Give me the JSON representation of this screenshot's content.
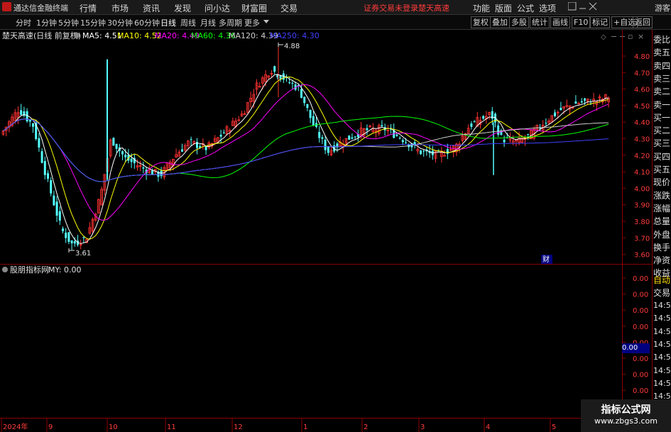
{
  "app": {
    "name": "通达信金融终端",
    "login_status": "证券交易未登录",
    "title_stock": "楚天高速",
    "guest": "游客"
  },
  "menu": [
    "行情",
    "市场",
    "资讯",
    "发现",
    "问小达",
    "财富圈",
    "交易"
  ],
  "right_menu": [
    "功能",
    "版面",
    "公式",
    "选项"
  ],
  "periods": [
    "分时",
    "1分钟",
    "5分钟",
    "15分钟",
    "30分钟",
    "60分钟",
    "日线",
    "周线",
    "月线",
    "多周期",
    "更多"
  ],
  "active_period": "日线",
  "toolbar_buttons": [
    "复权",
    "叠加",
    "多股",
    "统计",
    "画线",
    "F10",
    "标记",
    "+自选",
    "返回"
  ],
  "main_chart": {
    "title": "楚天高速(日线 前复权)",
    "ma": [
      {
        "label": "MA5: 4.51",
        "color": "#ffffff"
      },
      {
        "label": "MA10: 4.52",
        "color": "#ffff00"
      },
      {
        "label": "MA20: 4.49",
        "color": "#ff00ff"
      },
      {
        "label": "MA60: 4.36",
        "color": "#00ff00"
      },
      {
        "label": "MA120: 4.39",
        "color": "#d0d0d0"
      },
      {
        "label": "MA250: 4.30",
        "color": "#4040ff"
      }
    ],
    "price_ticks": [
      "4.80",
      "4.70",
      "4.60",
      "4.50",
      "4.40",
      "4.30",
      "4.20",
      "4.10",
      "4.00",
      "3.90",
      "3.80",
      "3.70",
      "3.60"
    ],
    "high_label": "4.88",
    "low_label": "3.61",
    "finance_marker": "财"
  },
  "indicator": {
    "title": "股朋指标网",
    "value_label": "MY: 0.00",
    "ticks": [
      "0.00",
      "0.00",
      "0.00",
      "0.00",
      "0.00",
      "0.00",
      "0.00",
      "0.00",
      "0.00"
    ],
    "current_value": "0.00"
  },
  "date_axis": [
    "2024年",
    "9",
    "10",
    "11",
    "12",
    "1",
    "2",
    "3",
    "4",
    "5"
  ],
  "side_labels": [
    "委比",
    "卖五",
    "卖四",
    "卖三",
    "卖二",
    "卖一",
    "买一",
    "买二",
    "买三",
    "买四",
    "买五",
    "现价",
    "涨跌",
    "涨幅",
    "总量",
    "外盘",
    "换手",
    "净资",
    "收益"
  ],
  "side_bottom": [
    "自动",
    "交易"
  ],
  "side_times": [
    "14:56",
    "14:56",
    "14:56",
    "14:56",
    "14:56",
    "14:56",
    "14:56",
    "14:56"
  ],
  "watermark": {
    "title": "指标公式网",
    "url": "www.zbgs3.com"
  },
  "colors": {
    "up": "#ff3232",
    "down": "#54ffff",
    "accent": "#ff3b3b",
    "border": "#8b0000"
  }
}
